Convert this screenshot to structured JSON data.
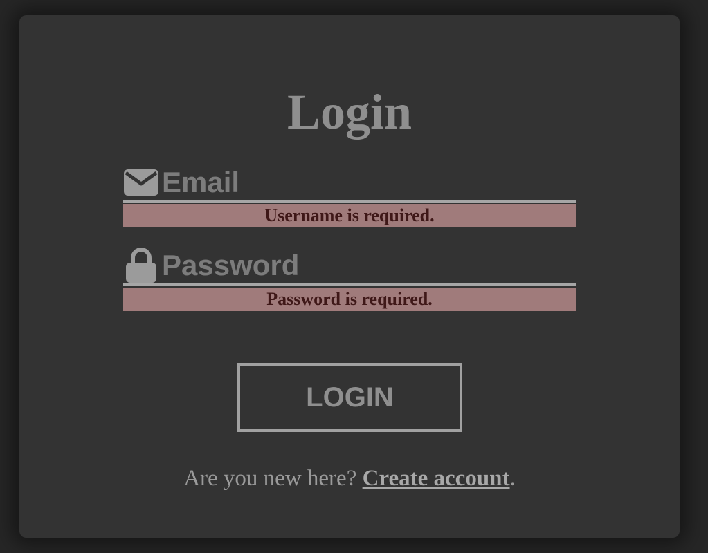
{
  "form": {
    "title": "Login",
    "email": {
      "icon": "envelope-icon",
      "label": "Email",
      "value": "",
      "error": "Username is required."
    },
    "password": {
      "icon": "lock-icon",
      "label": "Password",
      "value": "",
      "error": "Password is required."
    },
    "submit_label": "LOGIN",
    "signup": {
      "prompt": "Are you new here? ",
      "link_label": "Create account",
      "suffix": "."
    }
  },
  "colors": {
    "background": "#262626",
    "card": "#333333",
    "error_bg": "#a07b7b",
    "error_text": "#3f1818",
    "muted_text": "#8f8f8f"
  }
}
